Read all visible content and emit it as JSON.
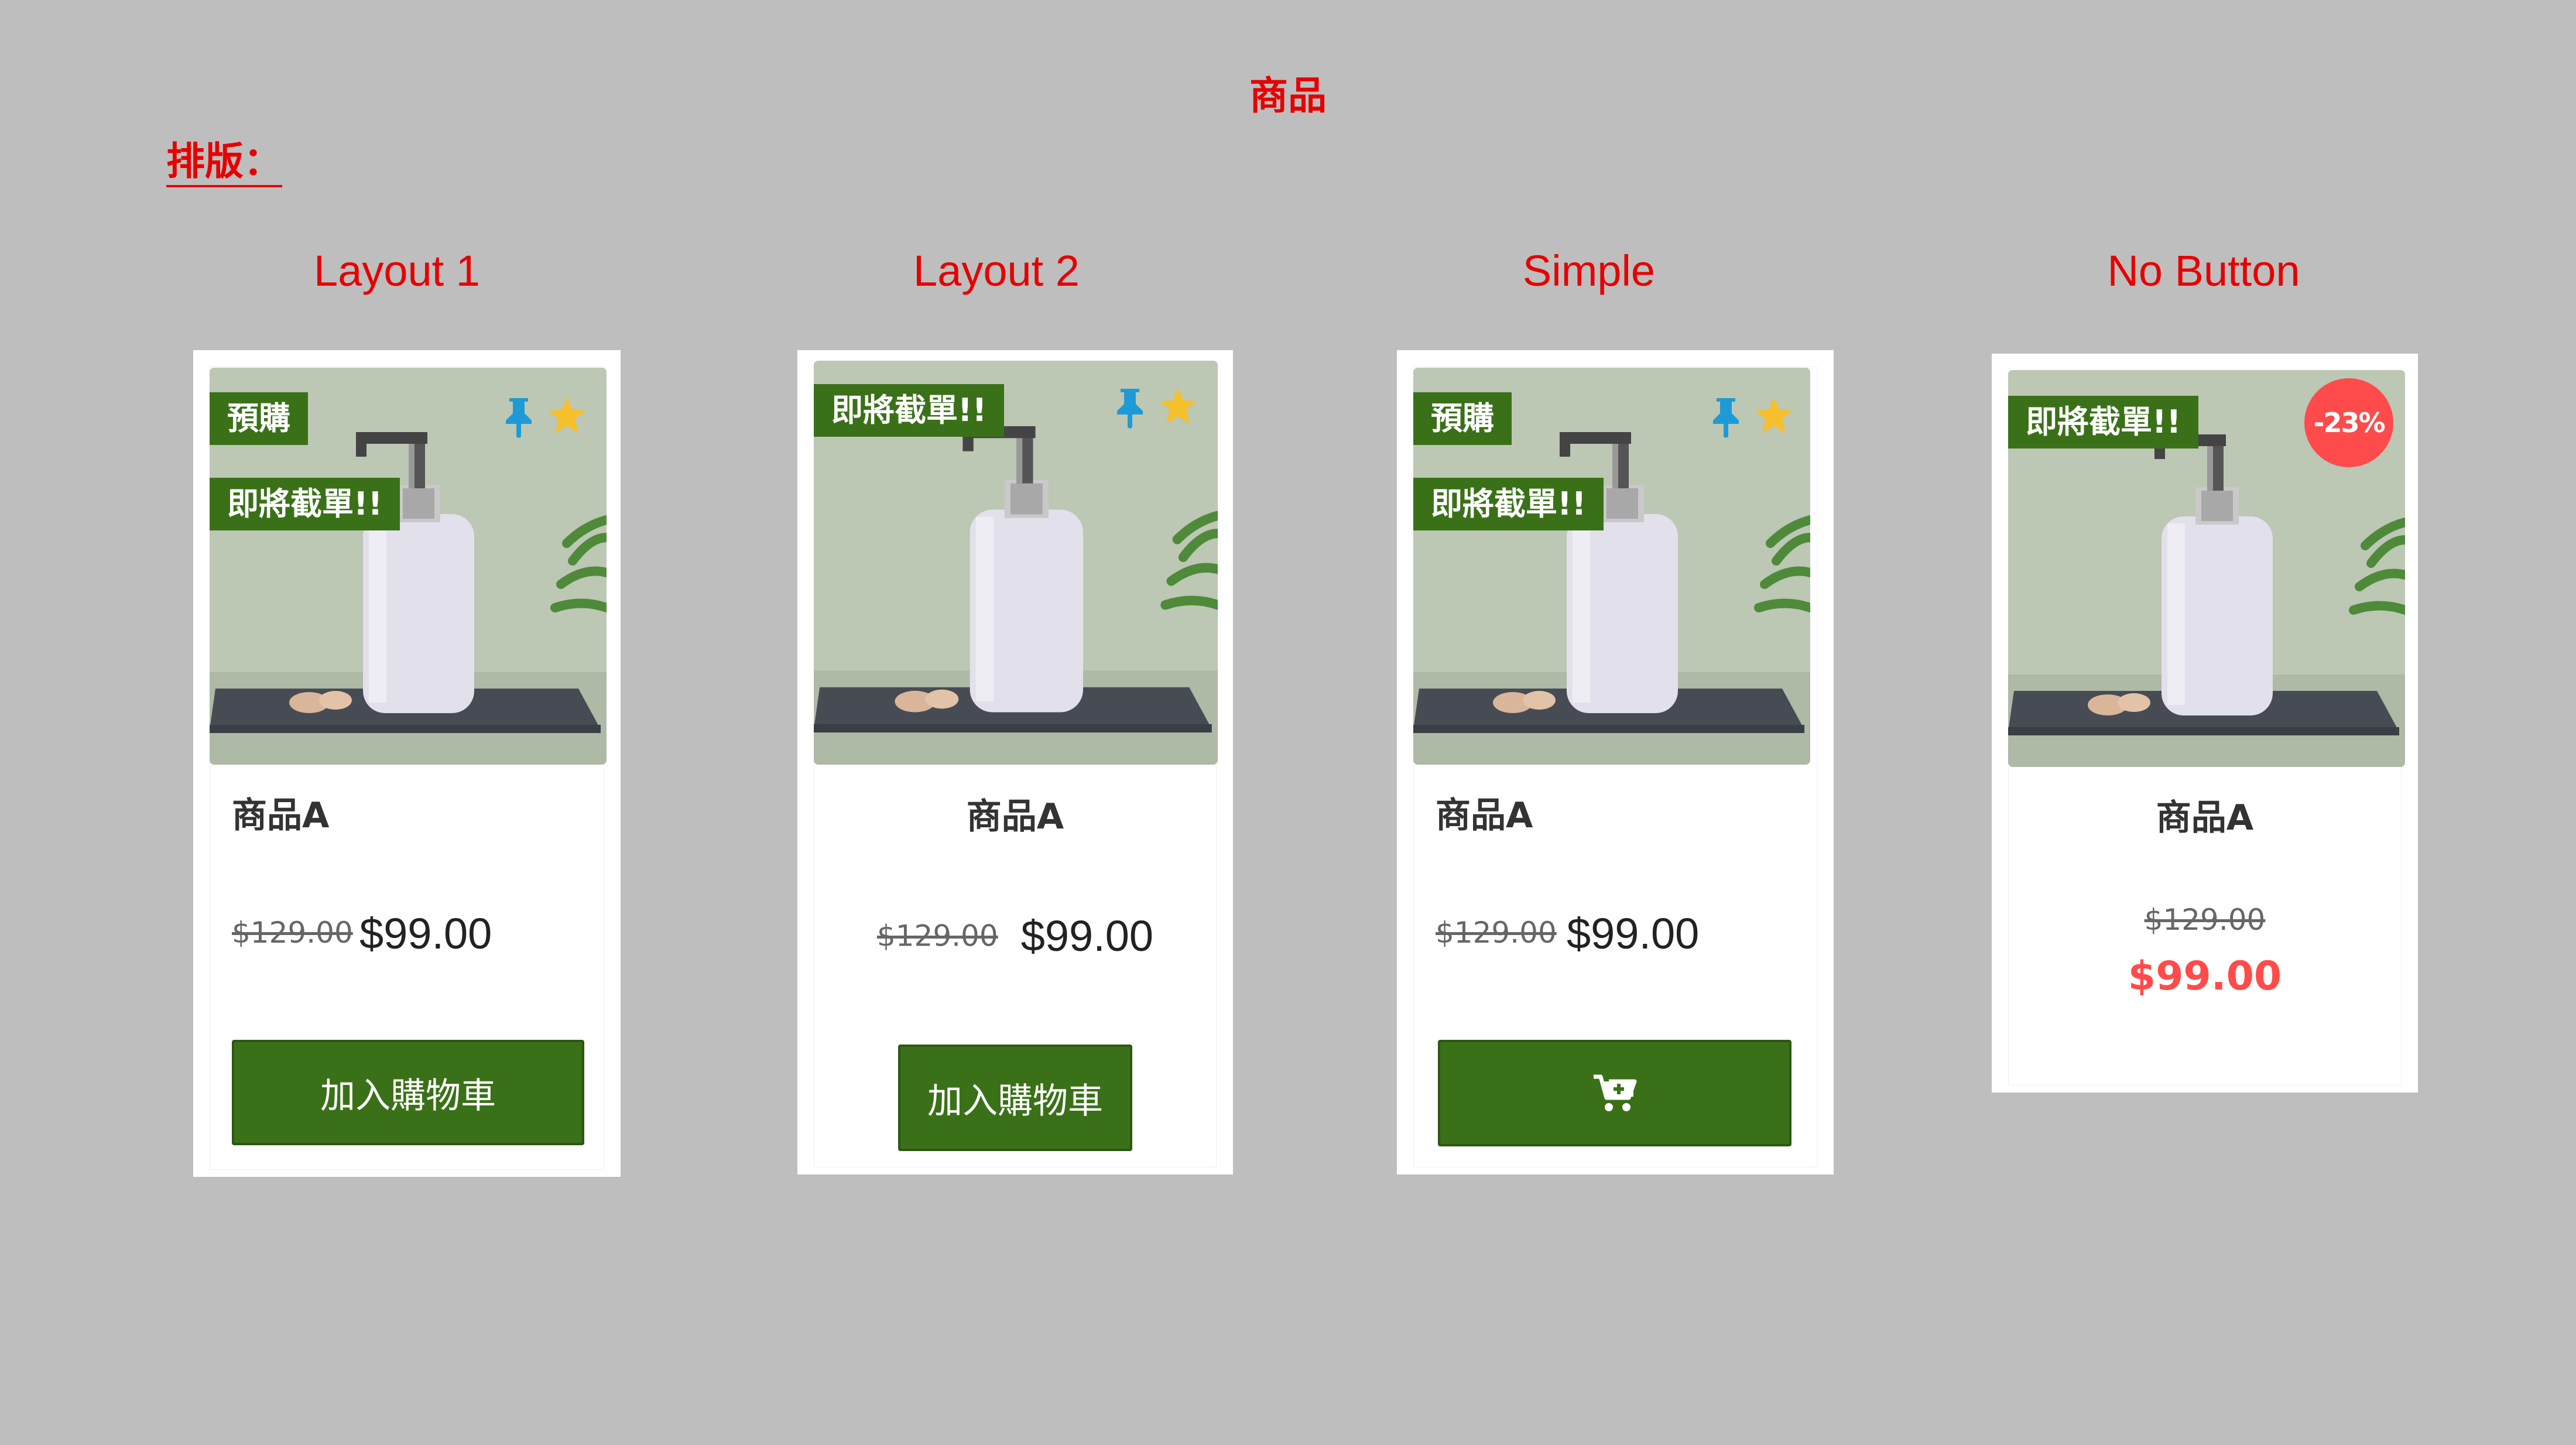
{
  "page": {
    "title": "商品",
    "layout_heading": "排版："
  },
  "product": {
    "name": "商品A",
    "old_price": "$129.00",
    "new_price": "$99.00",
    "tag_preorder": "預購",
    "tag_closing": "即將截單!!",
    "discount": "-23%",
    "add_to_cart": "加入購物車"
  },
  "sections": [
    {
      "label": "Layout 1"
    },
    {
      "label": "Layout 2"
    },
    {
      "label": "Simple"
    },
    {
      "label": "No Button"
    }
  ],
  "icons": {
    "pin": "pin-icon",
    "star": "star-icon",
    "cart": "cart-plus-icon"
  },
  "colors": {
    "accent_red": "#e60000",
    "button_green": "#3a7118",
    "sale_red": "#ff4b4b",
    "pin_blue": "#1e9bd7",
    "star_yellow": "#f6c02c",
    "background": "#bebebe"
  }
}
